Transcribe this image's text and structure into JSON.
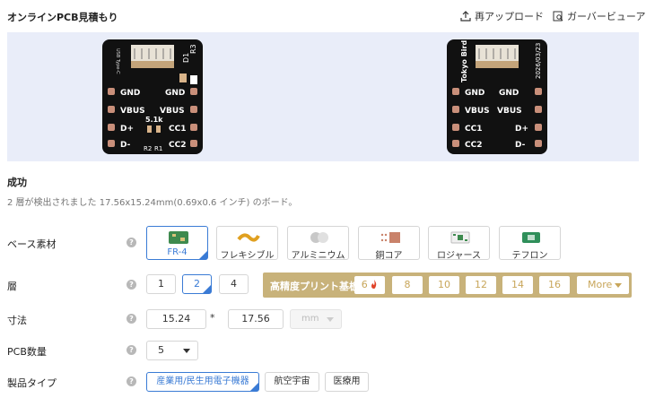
{
  "header": {
    "title": "オンラインPCB見積もり",
    "reupload": "再アップロード",
    "gerber_viewer": "ガーバービューア"
  },
  "preview": {
    "left_board": {
      "silk": [
        "USB Type-C",
        "D1",
        "R3",
        "5.1k",
        "R2",
        "R1"
      ],
      "pads": [
        [
          "GND",
          "GND"
        ],
        [
          "VBUS",
          "VBUS"
        ],
        [
          "D+",
          "CC1"
        ],
        [
          "D-",
          "CC2"
        ]
      ]
    },
    "right_board": {
      "silk": [
        "Tokyo Bird",
        "2026/03/23"
      ],
      "pads": [
        [
          "GND",
          "GND"
        ],
        [
          "VBUS",
          "VBUS"
        ],
        [
          "CC1",
          "D+"
        ],
        [
          "CC2",
          "D-"
        ]
      ]
    }
  },
  "status": "成功",
  "detected": "2 層が検出されました 17.56x15.24mm(0.69x0.6 インチ) のボード。",
  "base_material": {
    "label": "ベース素材",
    "options": [
      "FR-4",
      "フレキシブル",
      "アルミニウム",
      "銅コア",
      "ロジャース",
      "テフロン"
    ],
    "selected": "FR-4"
  },
  "layers": {
    "label": "層",
    "options": [
      "1",
      "2",
      "4"
    ],
    "selected": "2",
    "hp_label": "高精度プリント基板",
    "hp_options": [
      "6",
      "8",
      "10",
      "12",
      "14",
      "16"
    ],
    "more": "More"
  },
  "dimensions": {
    "label": "寸法",
    "x": "15.24",
    "times": "*",
    "y": "17.56",
    "unit": "mm"
  },
  "quantity": {
    "label": "PCB数量",
    "value": "5"
  },
  "product_type": {
    "label": "製品タイプ",
    "options": [
      "産業用/民生用電子機器",
      "航空宇宙",
      "医療用"
    ],
    "selected": "産業用/民生用電子機器"
  },
  "help_glyph": "?",
  "colors": {
    "accent": "#3a7bd5",
    "gold": "#c8b27a",
    "preview_bg": "#e9edf9",
    "pcb": "#111111"
  }
}
